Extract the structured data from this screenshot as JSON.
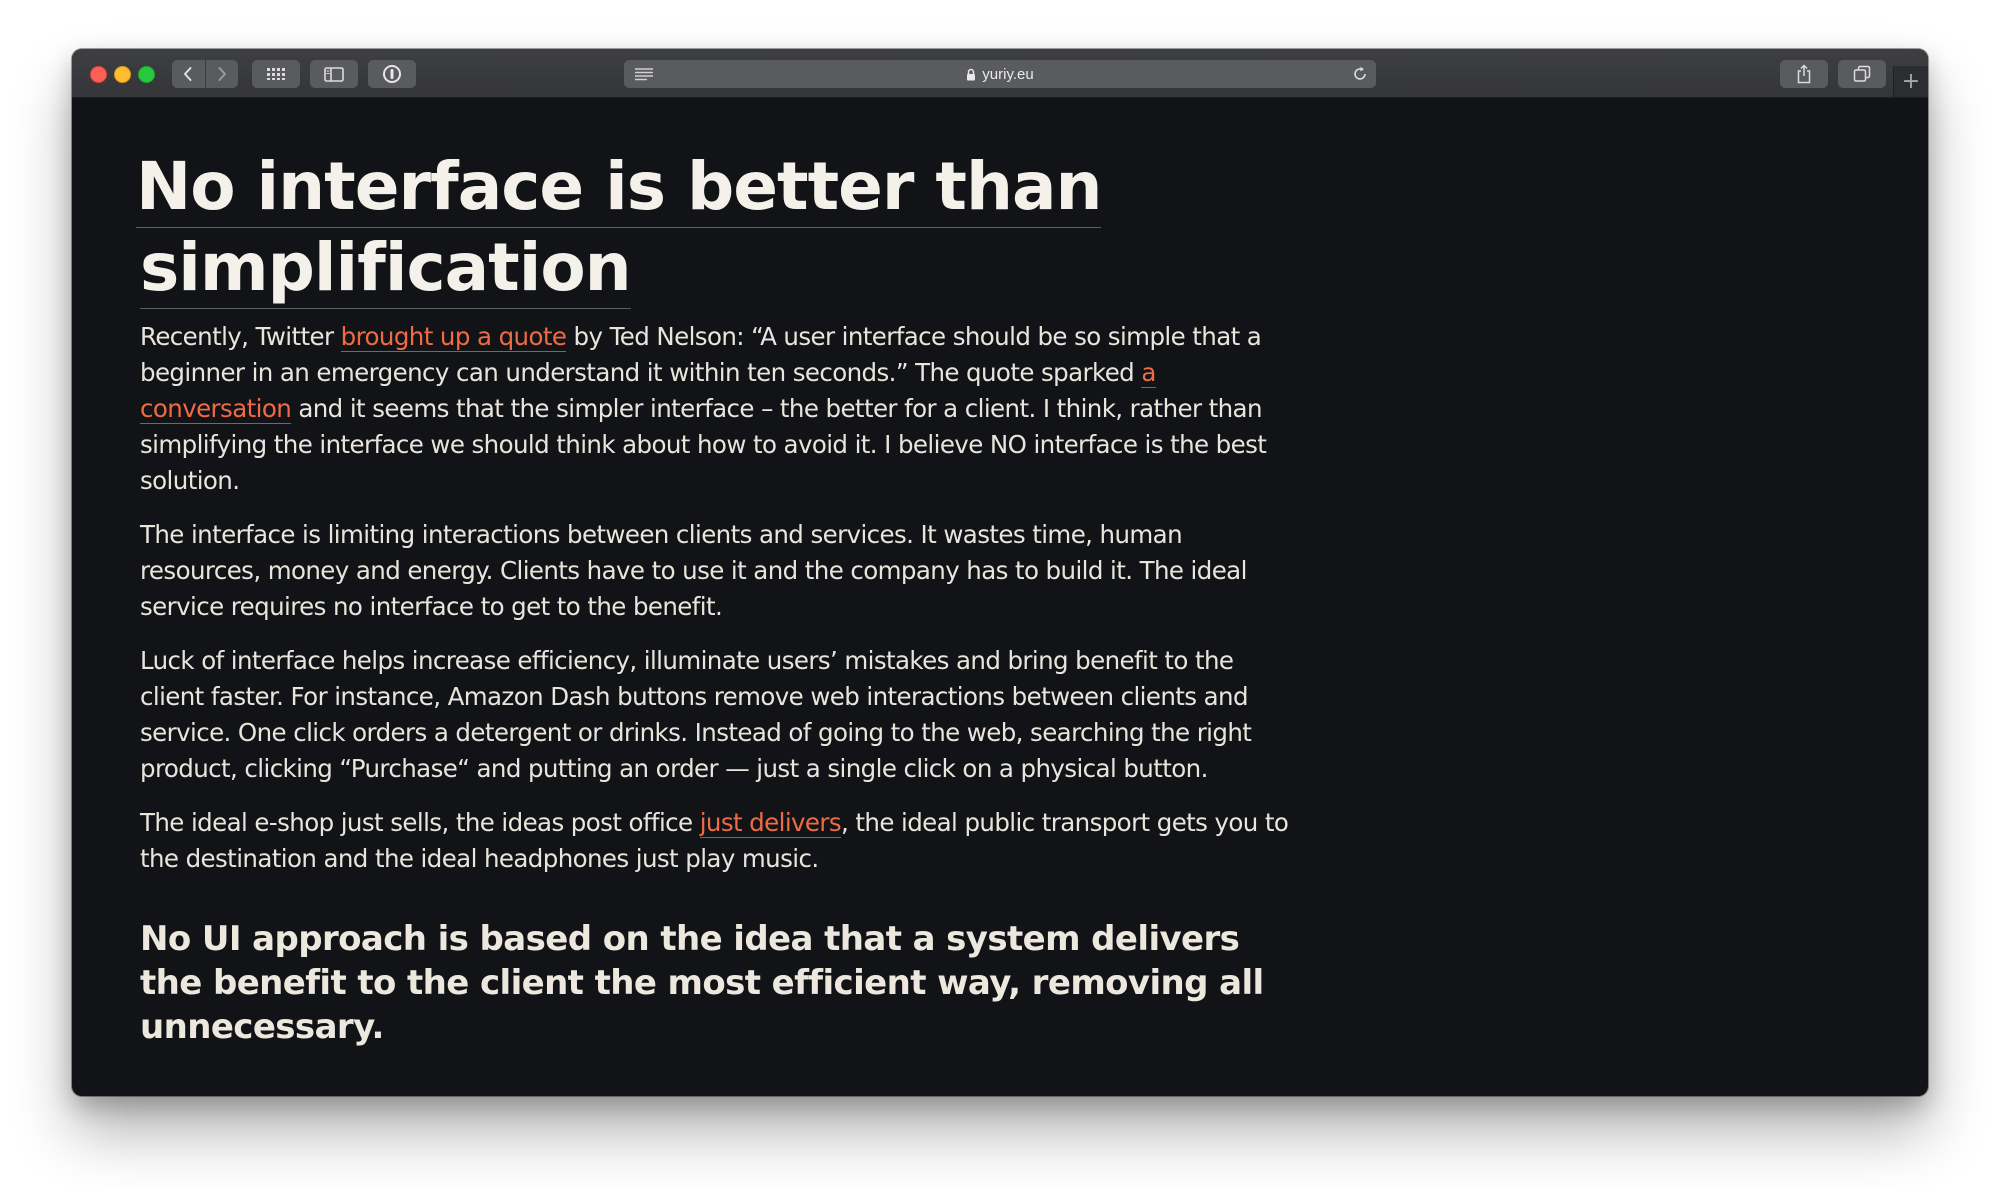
{
  "browser": {
    "url": "yuriy.eu",
    "new_tab_label": "+",
    "icons": {
      "back": "chevron-left-icon",
      "forward": "chevron-right-icon",
      "top_sites": "grid-icon",
      "sidebar": "sidebar-icon",
      "extension": "password-icon",
      "reader": "reader-icon",
      "lock": "lock-icon",
      "reload": "reload-icon",
      "share": "share-icon",
      "tabs": "tab-overview-icon"
    }
  },
  "article": {
    "title_line1": "No interface is better than",
    "title_line2": "simplification",
    "p1": {
      "t1": "Recently, Twitter ",
      "link1": "brought up a quote",
      "t2": " by Ted Nelson: “A user interface should be so simple that a beginner in an emergency can understand it within ten seconds.” The quote sparked ",
      "link2": "a conversation",
      "t3": " and it seems that the simpler interface – the better for a client. I think, rather than simplifying the interface we should think about how to avoid it. I believe NO interface is the best solution."
    },
    "p2": "The interface is limiting interactions between clients and services. It wastes time, human resources, money and energy. Clients have to use it and the company has to build it. The ideal service requires no interface to get to the benefit.",
    "p3": "Luck of interface helps increase efficiency, illuminate users’ mistakes and bring benefit to the client faster. For instance, Amazon Dash buttons remove web interactions between clients and service. One click orders a detergent or drinks. Instead of going to the web, searching the right product, clicking “Purchase“ and putting an order — just a single click on a physical button.",
    "p4": {
      "t1": "The ideal e-shop just sells, the ideas post office ",
      "link": "just delivers",
      "t2": ", the ideal public transport gets you to the destination and the ideal headphones just play music."
    },
    "subheading": "No UI approach is based on the idea that a system delivers the benefit to the client the most efficient way, removing all unnecessary."
  },
  "colors": {
    "page_background": "#111317",
    "text": "#e9e5dc",
    "link": "#f06a44",
    "toolbar": "#3a3b3e"
  }
}
